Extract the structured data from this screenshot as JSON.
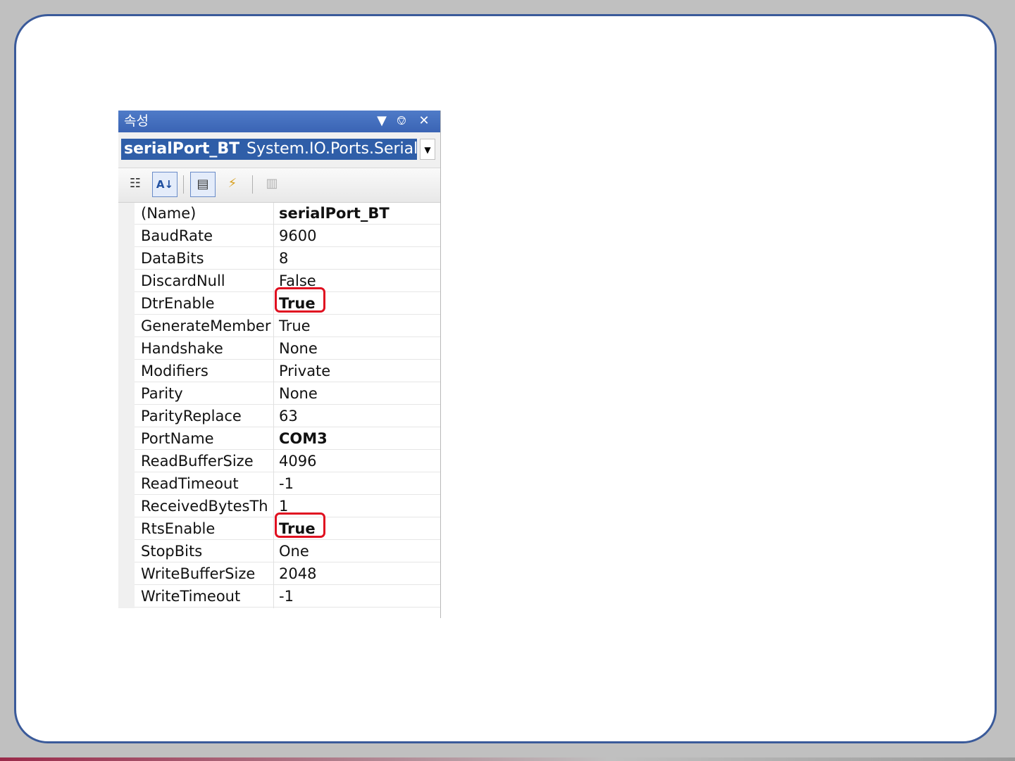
{
  "panel": {
    "title": "속성",
    "buttons": {
      "dropdown_icon": "dropdown-arrow",
      "pin_icon": "pin",
      "close_icon": "close"
    },
    "object_selector": {
      "name": "serialPort_BT",
      "type": "System.IO.Ports.Serial"
    },
    "toolbar": {
      "tools": [
        {
          "name": "categorized-icon",
          "glyph": "☷",
          "active": false
        },
        {
          "name": "alphabetical-icon",
          "glyph": "A↓",
          "active": true
        },
        {
          "name": "properties-icon",
          "glyph": "▤",
          "active": true
        },
        {
          "name": "events-icon",
          "glyph": "⚡",
          "active": false
        },
        {
          "name": "property-pages-icon",
          "glyph": "▥",
          "active": false,
          "disabled": true
        }
      ]
    },
    "properties": [
      {
        "name": "(Name)",
        "value": "serialPort_BT",
        "bold": true
      },
      {
        "name": "BaudRate",
        "value": "9600",
        "bold": false
      },
      {
        "name": "DataBits",
        "value": "8",
        "bold": false
      },
      {
        "name": "DiscardNull",
        "value": "False",
        "bold": false
      },
      {
        "name": "DtrEnable",
        "value": "True",
        "bold": true,
        "highlighted": true
      },
      {
        "name": "GenerateMember",
        "value": "True",
        "bold": false
      },
      {
        "name": "Handshake",
        "value": "None",
        "bold": false
      },
      {
        "name": "Modifiers",
        "value": "Private",
        "bold": false
      },
      {
        "name": "Parity",
        "value": "None",
        "bold": false
      },
      {
        "name": "ParityReplace",
        "value": "63",
        "bold": false
      },
      {
        "name": "PortName",
        "value": "COM3",
        "bold": true
      },
      {
        "name": "ReadBufferSize",
        "value": "4096",
        "bold": false
      },
      {
        "name": "ReadTimeout",
        "value": "-1",
        "bold": false
      },
      {
        "name": "ReceivedBytesTh",
        "value": "1",
        "bold": false
      },
      {
        "name": "RtsEnable",
        "value": "True",
        "bold": true,
        "highlighted": true
      },
      {
        "name": "StopBits",
        "value": "One",
        "bold": false
      },
      {
        "name": "WriteBufferSize",
        "value": "2048",
        "bold": false
      },
      {
        "name": "WriteTimeout",
        "value": "-1",
        "bold": false
      }
    ]
  },
  "colors": {
    "titlebar": "#3a64b4",
    "selection": "#2f5ea8",
    "highlight_box": "#e01020",
    "slide_border": "#3a5a9a"
  }
}
